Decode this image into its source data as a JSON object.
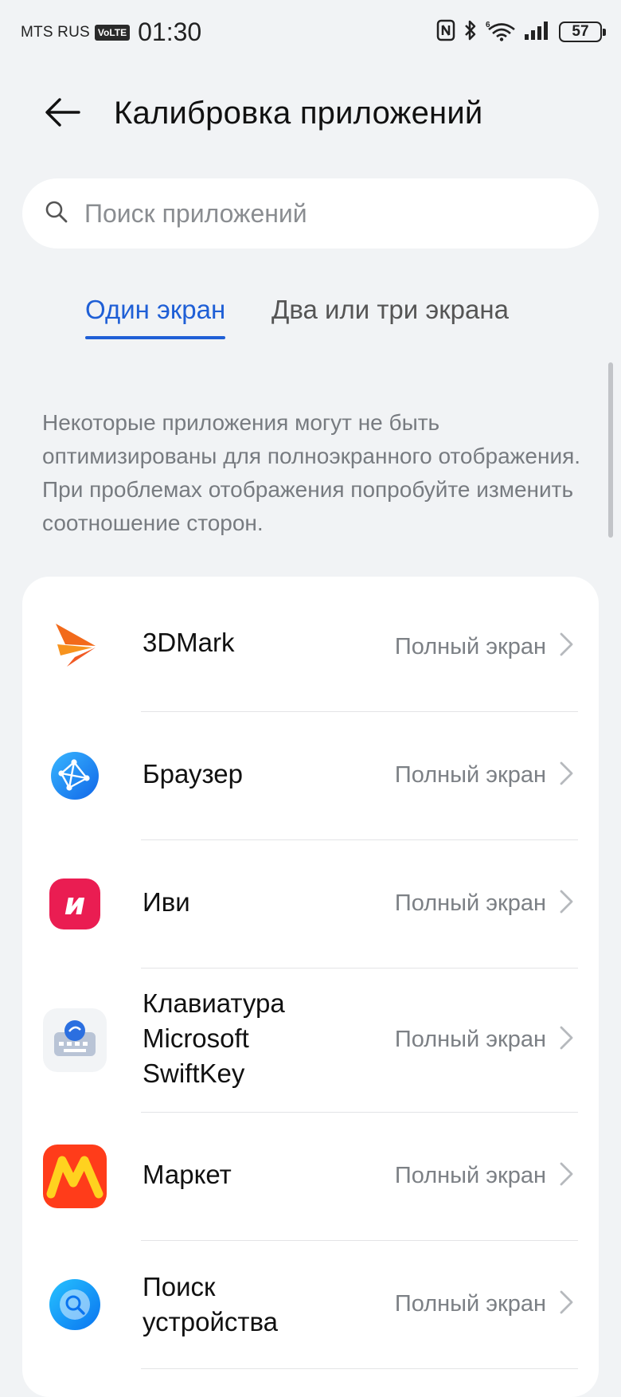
{
  "status_bar": {
    "carrier": "MTS RUS",
    "volte": "VoLTE",
    "time": "01:30",
    "battery": "57",
    "icons": [
      "nfc-icon",
      "bluetooth-icon",
      "wifi-icon",
      "signal-icon",
      "battery-icon"
    ]
  },
  "header": {
    "title": "Калибровка приложений",
    "back_icon": "back-arrow-icon"
  },
  "search": {
    "placeholder": "Поиск приложений",
    "value": ""
  },
  "tabs": [
    {
      "label": "Один экран",
      "active": true
    },
    {
      "label": "Два или три экрана",
      "active": false
    }
  ],
  "description": "Некоторые приложения могут не быть оптимизированы для полноэкранного отображения. При проблемах отображения попробуйте изменить соотношение сторон.",
  "apps": [
    {
      "name": "3DMark",
      "value": "Полный экран",
      "icon": "3dmark-icon"
    },
    {
      "name": "Браузер",
      "value": "Полный экран",
      "icon": "browser-icon"
    },
    {
      "name": "Иви",
      "value": "Полный экран",
      "icon": "ivi-icon"
    },
    {
      "name": "Клавиатура\nMicrosoft\nSwiftKey",
      "value": "Полный экран",
      "icon": "swiftkey-icon"
    },
    {
      "name": "Маркет",
      "value": "Полный экран",
      "icon": "market-icon"
    },
    {
      "name": "Поиск\nустройства",
      "value": "Полный экран",
      "icon": "find-device-icon"
    }
  ],
  "colors": {
    "accent": "#1f5fd6",
    "background": "#f1f3f5",
    "card": "#ffffff",
    "secondary_text": "#7c8085"
  }
}
